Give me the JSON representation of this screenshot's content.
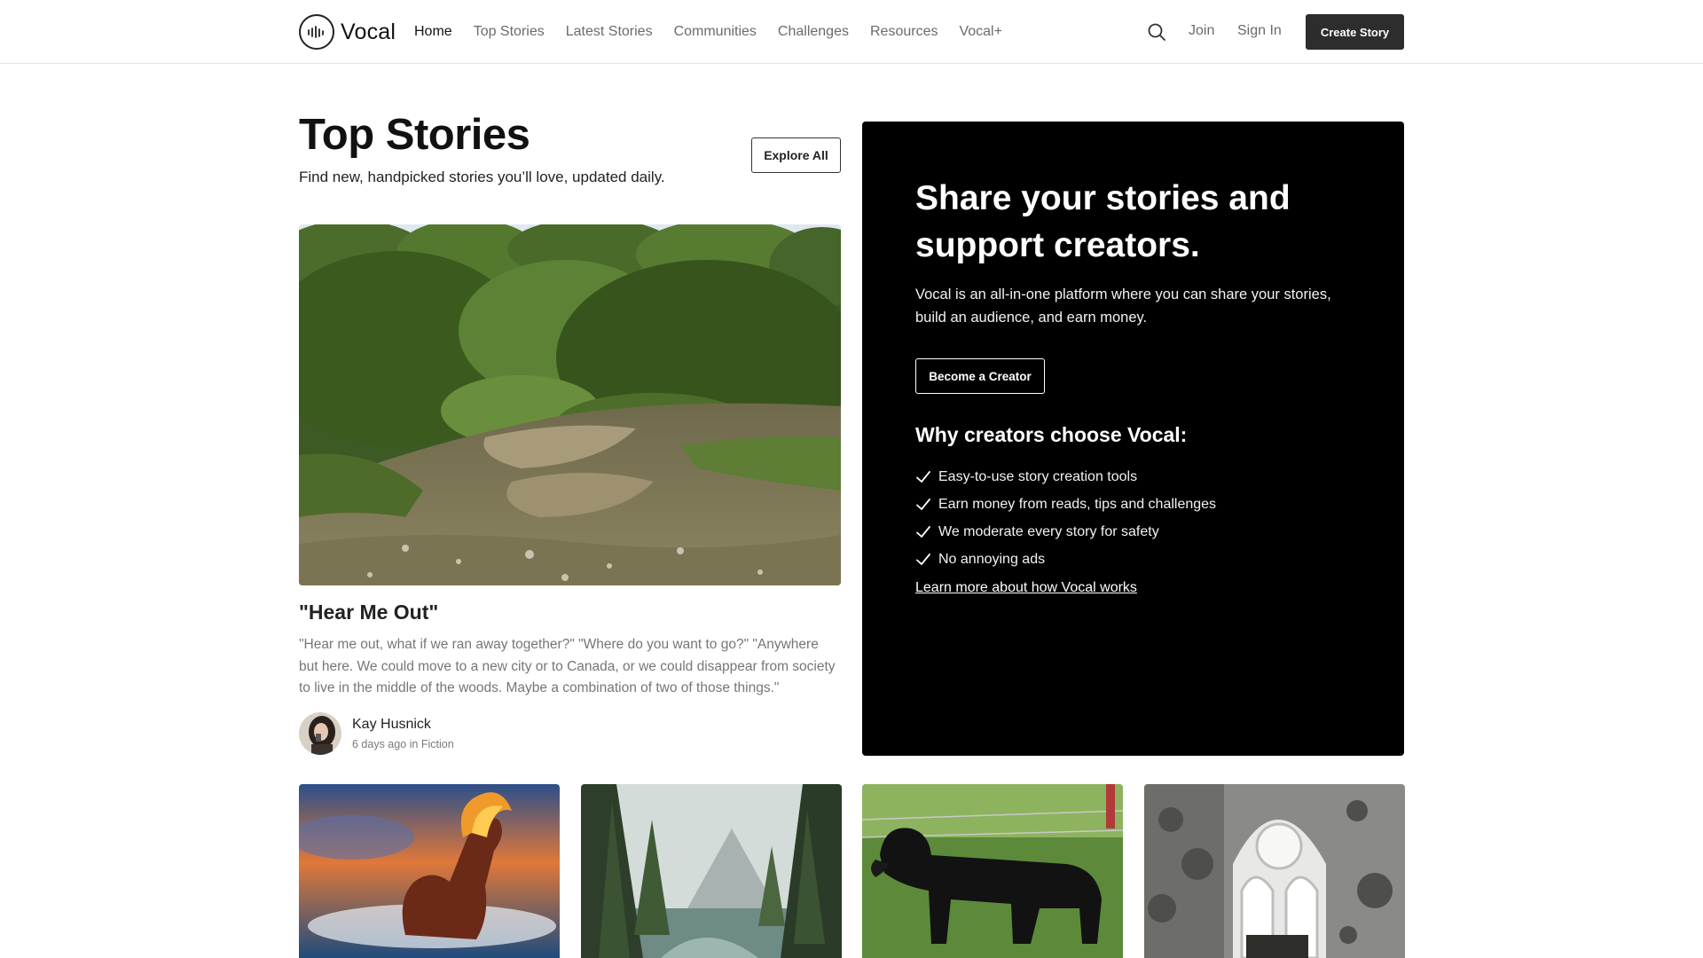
{
  "header": {
    "logo_text": "Vocal",
    "nav": [
      {
        "label": "Home",
        "active": true
      },
      {
        "label": "Top Stories",
        "active": false
      },
      {
        "label": "Latest Stories",
        "active": false
      },
      {
        "label": "Communities",
        "active": false
      },
      {
        "label": "Challenges",
        "active": false
      },
      {
        "label": "Resources",
        "active": false
      },
      {
        "label": "Vocal+",
        "active": false
      }
    ],
    "search_icon": "search-icon",
    "join_label": "Join",
    "signin_label": "Sign In",
    "create_label": "Create Story"
  },
  "top_stories": {
    "title": "Top Stories",
    "subtitle": "Find new, handpicked stories you’ll love, updated daily.",
    "explore_label": "Explore All",
    "feature": {
      "title": "\"Hear Me Out\"",
      "excerpt": "\"Hear me out, what if we ran away together?\" \"Where do you want to go?\" \"Anywhere but here. We could move to a new city or to Canada, or we could disappear from society to live in the middle of the woods. Maybe a combination of two of those things.\"",
      "author": "Kay Husnick",
      "meta": "6 days ago in Fiction",
      "image": "forest-creek-photo"
    },
    "thumbnails": [
      "fire-horse-photo",
      "forest-lake-photo",
      "black-dog-photo",
      "ruined-window-photo"
    ]
  },
  "promo": {
    "title": "Share your stories and support creators.",
    "text": "Vocal is an all-in-one platform where you can share your stories, build an audience, and earn money.",
    "button_label": "Become a Creator",
    "why_heading": "Why creators choose Vocal:",
    "reasons": [
      "Easy-to-use story creation tools",
      "Earn money from reads, tips and challenges",
      "We moderate every story for safety",
      "No annoying ads"
    ],
    "learn_more": "Learn more about how Vocal works"
  },
  "colors": {
    "brand_dark": "#2d2d2d",
    "promo_bg": "#000000",
    "muted_text": "#767676"
  }
}
